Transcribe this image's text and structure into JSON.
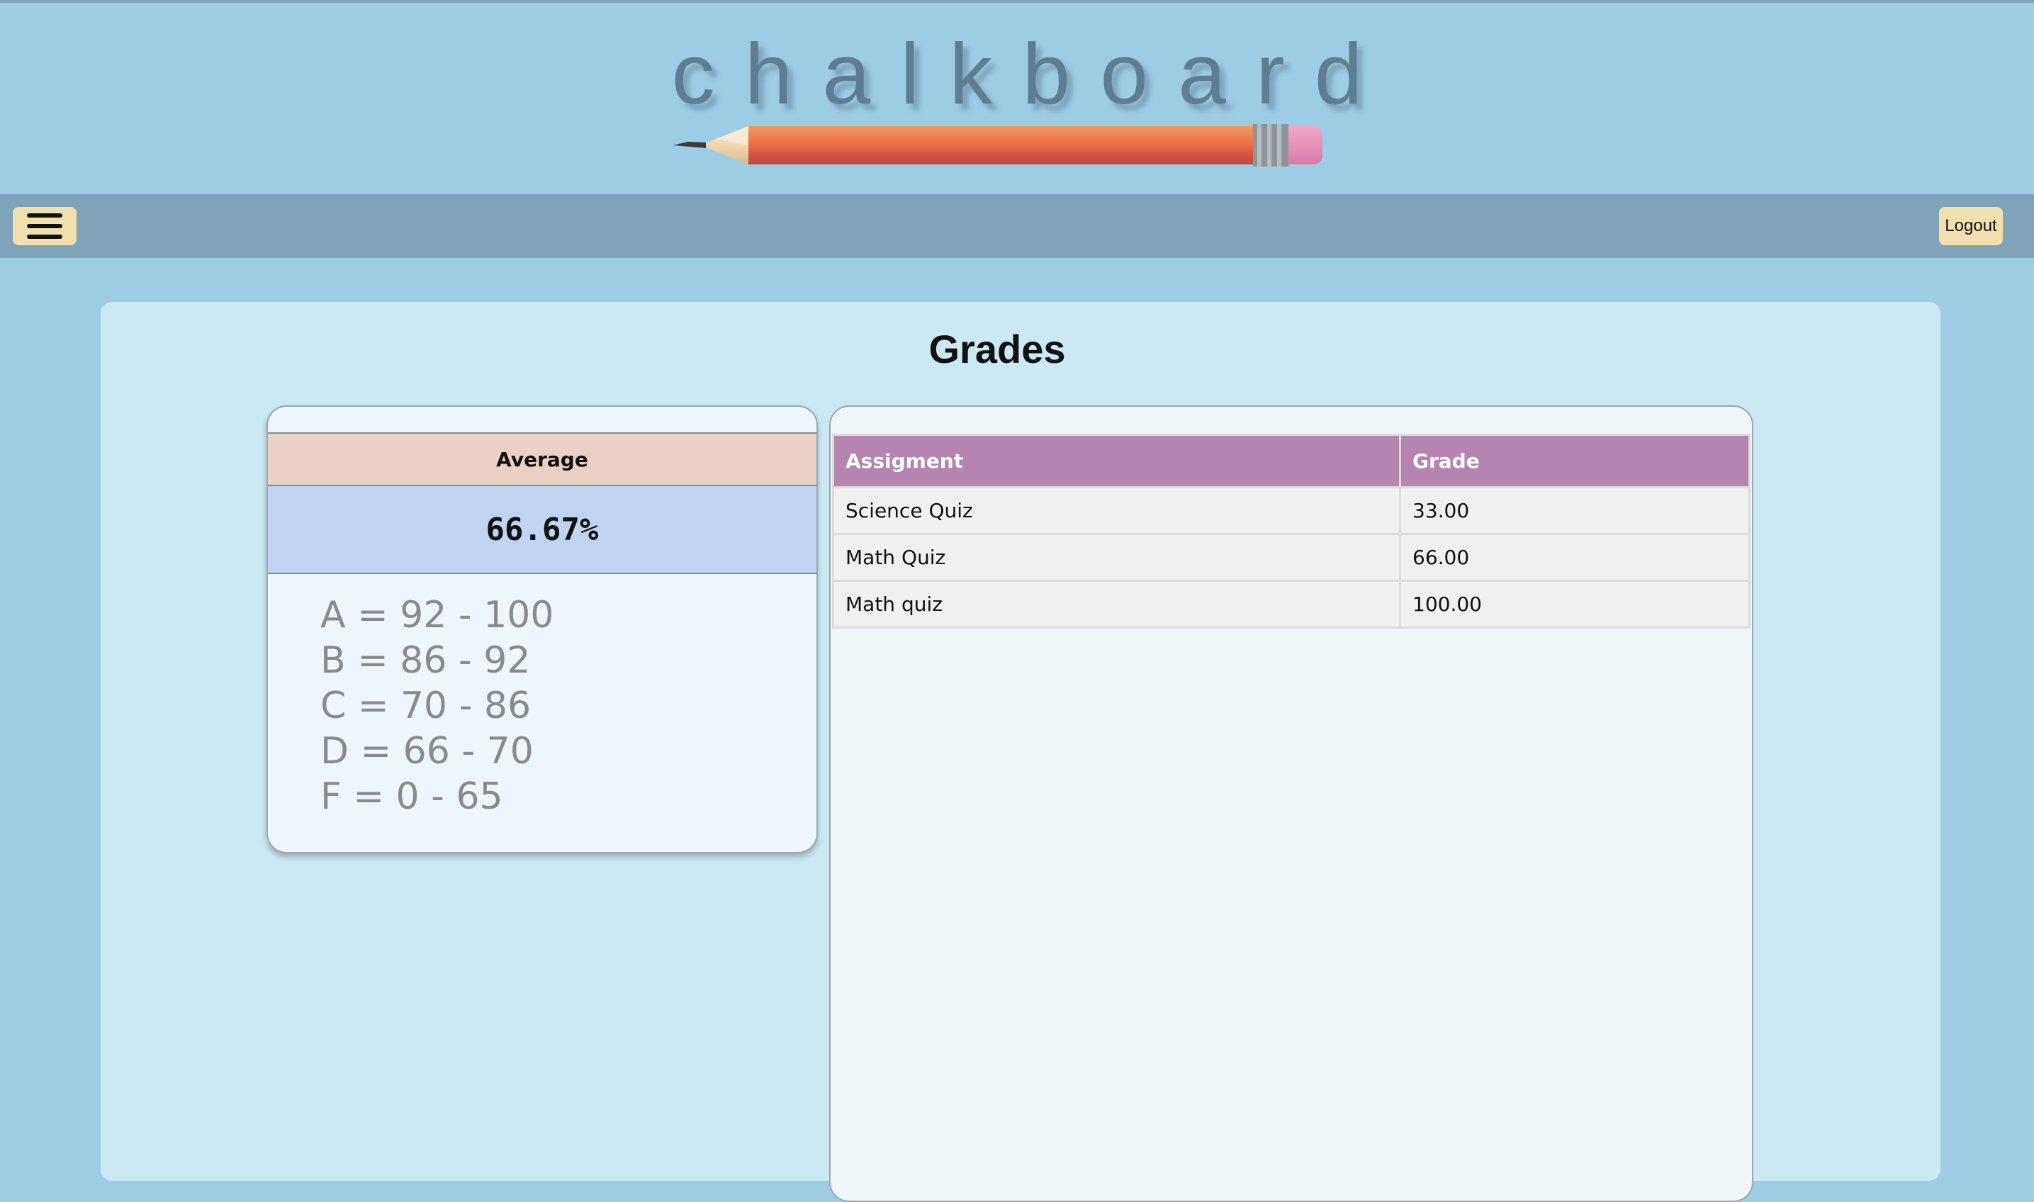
{
  "header": {
    "logo_text": "chalkboard"
  },
  "navbar": {
    "menu_icon": "hamburger-menu-icon",
    "logout_label": "Logout"
  },
  "page": {
    "title": "Grades"
  },
  "average": {
    "header": "Average",
    "value": "66.67%",
    "scale": [
      "A = 92 - 100",
      "B = 86 - 92",
      "C = 70 - 86",
      "D = 66 - 70",
      "F = 0 - 65"
    ]
  },
  "grades_table": {
    "columns": [
      "Assigment",
      "Grade"
    ],
    "rows": [
      {
        "assignment": "Science Quiz",
        "grade": "33.00"
      },
      {
        "assignment": "Math Quiz",
        "grade": "66.00"
      },
      {
        "assignment": "Math quiz",
        "grade": "100.00"
      }
    ]
  },
  "colors": {
    "background": "#9dcde4",
    "navbar": "#7fa4ba",
    "panel": "#cce8f3",
    "button": "#f1dfad",
    "table_header": "#b585b0",
    "average_header": "#ead0c6",
    "average_value": "#c1d3f1"
  }
}
